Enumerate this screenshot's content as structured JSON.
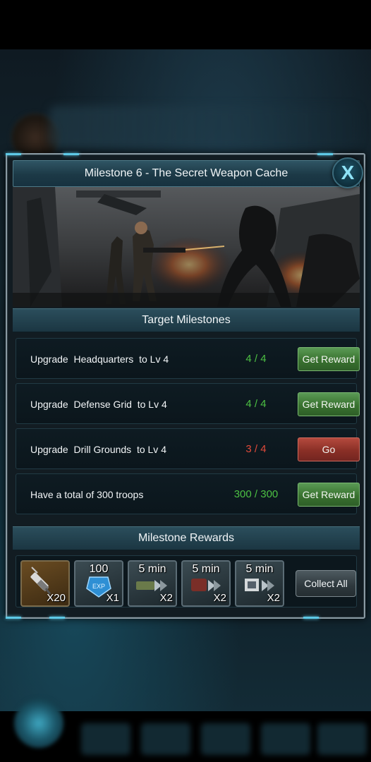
{
  "modal": {
    "title": "Milestone 6 - The Secret Weapon Cache",
    "close_glyph": "X",
    "targets_header": "Target Milestones",
    "rewards_header": "Milestone Rewards"
  },
  "milestones": [
    {
      "label": "Upgrade  Headquarters  to Lv 4",
      "progress": "4 / 4",
      "status": "complete",
      "button": "Get Reward"
    },
    {
      "label": "Upgrade  Defense Grid  to Lv 4",
      "progress": "4 / 4",
      "status": "complete",
      "button": "Get Reward"
    },
    {
      "label": "Upgrade  Drill Grounds  to Lv 4",
      "progress": "3 / 4",
      "status": "incomplete",
      "button": "Go"
    },
    {
      "label": "Have a total of 300 troops",
      "progress": "300 / 300",
      "status": "complete",
      "button": "Get Reward"
    }
  ],
  "rewards": [
    {
      "icon": "syringe-icon",
      "top": "",
      "qty": "X20"
    },
    {
      "icon": "exp-badge-icon",
      "top": "100",
      "qty": "X1"
    },
    {
      "icon": "speedup-icon",
      "top": "5 min",
      "qty": "X2"
    },
    {
      "icon": "speedup-icon",
      "top": "5 min",
      "qty": "X2"
    },
    {
      "icon": "speedup-icon",
      "top": "5 min",
      "qty": "X2"
    }
  ],
  "collect_all": "Collect All",
  "exp_label": "EXP",
  "colors": {
    "complete": "#4cc043",
    "incomplete": "#e04a3a",
    "accent": "#5ec9e6"
  }
}
